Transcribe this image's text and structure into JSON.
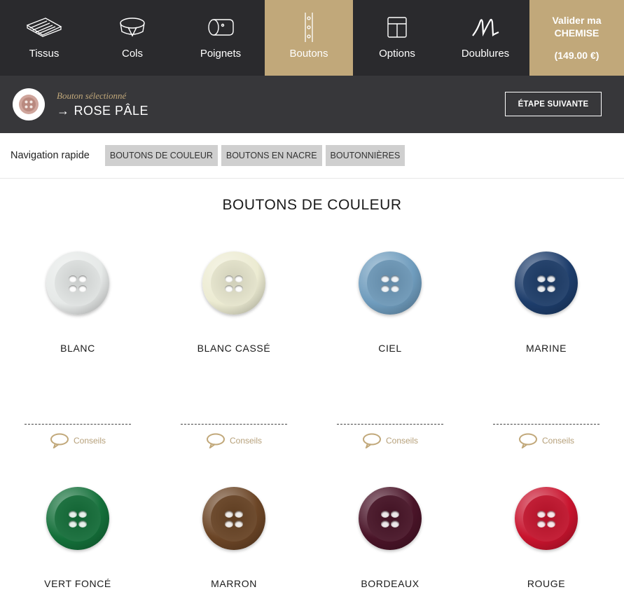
{
  "nav": {
    "items": [
      {
        "label": "Tissus",
        "icon": "fabric-icon"
      },
      {
        "label": "Cols",
        "icon": "collar-icon"
      },
      {
        "label": "Poignets",
        "icon": "cuff-icon"
      },
      {
        "label": "Boutons",
        "icon": "buttons-icon"
      },
      {
        "label": "Options",
        "icon": "options-icon"
      },
      {
        "label": "Doublures",
        "icon": "lining-icon"
      }
    ],
    "active_index": 3,
    "validate": {
      "line1": "Valider ma",
      "line2": "CHEMISE",
      "price": "(149.00 €)"
    }
  },
  "selection": {
    "caption": "Bouton sélectionné",
    "arrow": "→",
    "name": "ROSE PÂLE",
    "next_label": "ÉTAPE SUIVANTE"
  },
  "quicknav": {
    "label": "Navigation rapide",
    "links": [
      "BOUTONS DE COULEUR",
      "BOUTONS EN NACRE",
      "BOUTONNIÈRES"
    ]
  },
  "section": {
    "title": "BOUTONS DE COULEUR",
    "conseil_label": "Conseils",
    "buttons": [
      {
        "name": "BLANC",
        "color": "#e6e9e8"
      },
      {
        "name": "BLANC CASSÉ",
        "color": "#ecebd2"
      },
      {
        "name": "CIEL",
        "color": "#6f9cbd"
      },
      {
        "name": "MARINE",
        "color": "#1d3d6b"
      },
      {
        "name": "VERT FONCÉ",
        "color": "#14703a"
      },
      {
        "name": "MARRON",
        "color": "#6b4526"
      },
      {
        "name": "BORDEAUX",
        "color": "#4a1428"
      },
      {
        "name": "ROUGE",
        "color": "#c8142e"
      }
    ]
  },
  "colors": {
    "nav_bg": "#2a2a2d",
    "accent_gold": "#c1a87a",
    "selection_bar": "#37373a",
    "selected_button": "#cfa59c"
  }
}
